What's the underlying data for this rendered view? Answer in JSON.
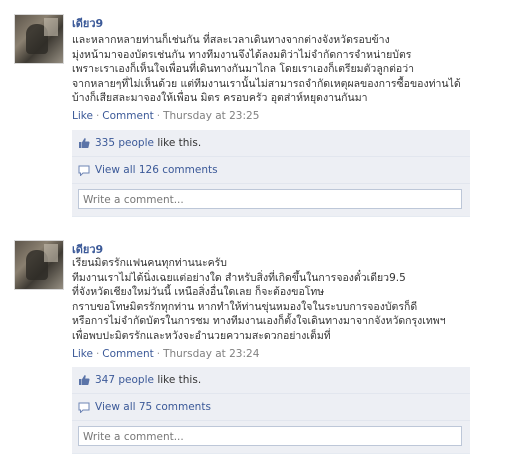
{
  "posts": [
    {
      "author": "เดียว9",
      "body": "และหลากหลายท่านก็เช่นกัน ที่สละเวลาเดินทางจากต่างจังหวัดรอบข้าง\nมุ่งหน้ามาจองบัตรเช่นกัน ทางทีมงานจึงได้ลงมติว่าไม่จำกัดการจำหน่ายบัตร\nเพราะเราเองก็เห็นใจเพื่อนที่เดินทางกันมาไกล โดยเราเองก็เตรียมตัวลูกต่อว่า\nจากหลายๆที่ไม่เห็นด้วย แต่ทีมงานเรานั้นไม่สามารถจำกัดเหตุผลของการซื้อของท่านได้\nบ้างก็เสียสละมาจองให้เพื่อน มิตร ครอบครัว อุตส่าห์หยุดงานกันมา",
      "actions": {
        "like": "Like",
        "comment": "Comment",
        "time": "Thursday at 23:25"
      },
      "likes_text": "335 people",
      "likes_suffix": " like this.",
      "view_comments": "View all 126 comments",
      "comment_placeholder": "Write a comment..."
    },
    {
      "author": "เดียว9",
      "body": "เรียนมิตรรักแฟนคนทุกท่านนะครับ\nทีมงานเราไม่ได้นิ่งเฉยแต่อย่างใด สำหรับสิ่งที่เกิดขึ้นในการจองตั๋วเดียว9.5\nที่จังหวัดเชียงใหม่วันนี้ เหนือสิ่งอื่นใดเลย ก็จะต้องขอโทษ\nกราบขอโทษมิตรรักทุกท่าน หากทำให้ท่านขุ่นหมองใจในระบบการจองบัตรก็ดี\nหรือการไม่จำกัดบัตรในการชม ทางทีมงานเองก็ตั้งใจเดินทางมาจากจังหวัดกรุงเทพฯ\nเพื่อพบปะมิตรรักและหวังจะอำนวยความสะดวกอย่างเต็มที่",
      "actions": {
        "like": "Like",
        "comment": "Comment",
        "time": "Thursday at 23:24"
      },
      "likes_text": "347 people",
      "likes_suffix": " like this.",
      "view_comments": "View all 75 comments",
      "comment_placeholder": "Write a comment..."
    }
  ],
  "icons": {
    "like": "thumbs-up-icon",
    "comment": "speech-bubble-icon"
  },
  "colors": {
    "link": "#3b5998",
    "box_bg": "#edeff4",
    "meta": "#808080",
    "input_border": "#bdc7d8"
  }
}
